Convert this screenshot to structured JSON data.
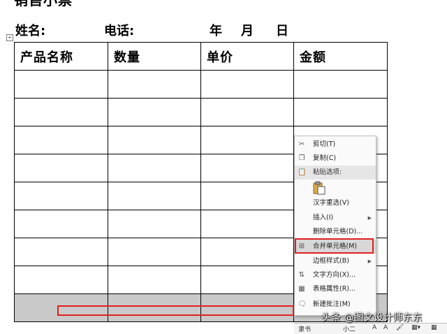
{
  "document": {
    "title": "销售小票",
    "info_row": {
      "name_label": "姓名:",
      "phone_label": "电话:",
      "year": "年",
      "month": "月",
      "day": "日"
    },
    "table": {
      "headers": [
        "产品名称",
        "数量",
        "单价",
        "金额"
      ],
      "empty_rows": 9
    }
  },
  "context_menu": {
    "items": [
      {
        "label": "剪切(T)",
        "icon": "scissors-icon"
      },
      {
        "label": "复制(C)",
        "icon": "copy-icon"
      },
      {
        "label": "粘贴选项:",
        "icon": "paste-icon"
      },
      {
        "label": "汉字重选(V)"
      },
      {
        "label": "插入(I)",
        "submenu": true
      },
      {
        "label": "删除单元格(D)..."
      },
      {
        "label": "合并单元格(M)",
        "icon": "merge-cells-icon",
        "highlighted": true
      },
      {
        "label": "边框样式(B)",
        "submenu": true
      },
      {
        "label": "文字方向(X)...",
        "icon": "text-direction-icon"
      },
      {
        "label": "表格属性(R)...",
        "icon": "table-properties-icon"
      },
      {
        "label": "新建批注(M)",
        "icon": "new-comment-icon"
      }
    ]
  },
  "mini_toolbar": {
    "font": "隶书",
    "size": "小二"
  },
  "watermark": "头条 @图文设计师东东",
  "colors": {
    "highlight_border": "#e02020",
    "selected_row": "#c9c9c9"
  }
}
